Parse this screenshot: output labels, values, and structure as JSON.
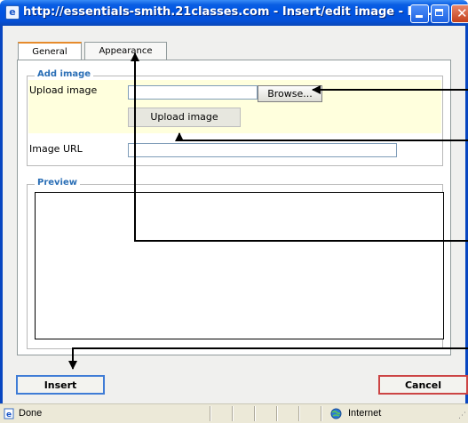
{
  "window": {
    "title": "http://essentials-smith.21classes.com - Insert/edit image - M...",
    "icon": "ie-page-icon"
  },
  "tabs": [
    {
      "label": "General",
      "active": true
    },
    {
      "label": "Appearance",
      "active": false
    }
  ],
  "add_image": {
    "legend": "Add image",
    "upload_label": "Upload image",
    "upload_value": "",
    "browse_label": "Browse...",
    "upload_button_label": "Upload image",
    "url_label": "Image URL",
    "url_value": ""
  },
  "preview": {
    "legend": "Preview"
  },
  "actions": {
    "insert_label": "Insert",
    "cancel_label": "Cancel"
  },
  "status_bar": {
    "status_text": "Done",
    "zone_text": "Internet"
  },
  "colors": {
    "title_bar": "#0054e3",
    "legend": "#2b6fb6",
    "highlight_area": "#ffffdd",
    "insert_border": "#3f7cd6",
    "cancel_border": "#cc4444"
  }
}
